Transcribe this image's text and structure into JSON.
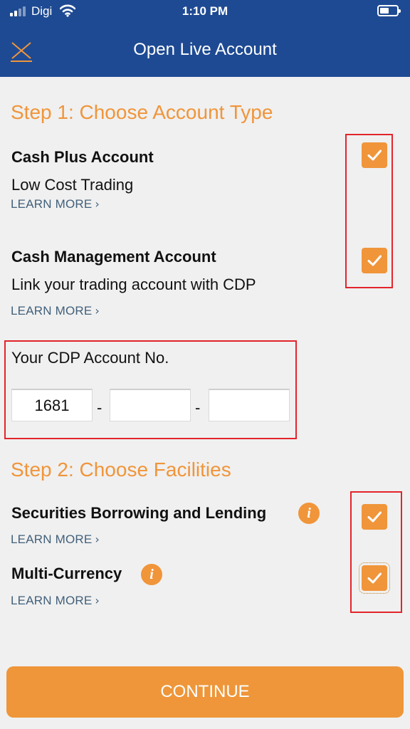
{
  "status_bar": {
    "carrier": "Digi",
    "time": "1:10 PM"
  },
  "nav": {
    "title": "Open Live Account",
    "close_icon": "close-icon"
  },
  "step1": {
    "title": "Step 1: Choose Account Type",
    "cash_plus": {
      "name": "Cash Plus Account",
      "desc": "Low Cost Trading",
      "learn_more": "LEARN MORE",
      "checked": true
    },
    "cash_mgmt": {
      "name": "Cash Management Account",
      "desc": "Link your trading account with CDP",
      "learn_more": "LEARN MORE",
      "checked": true
    },
    "cdp": {
      "label": "Your CDP Account No.",
      "part1": "1681",
      "part2": "",
      "part3": "",
      "separator": "-"
    }
  },
  "step2": {
    "title": "Step 2: Choose Facilities",
    "sbl": {
      "name": "Securities Borrowing and Lending",
      "learn_more": "LEARN MORE",
      "checked": true,
      "info_icon": "info-icon"
    },
    "multi_currency": {
      "name": "Multi-Currency",
      "learn_more": "LEARN MORE",
      "checked": true,
      "info_icon": "info-icon"
    }
  },
  "continue_button": {
    "label": "CONTINUE"
  },
  "colors": {
    "nav_bg": "#1e4a93",
    "accent": "#f0953a",
    "highlight_box": "#e3242b",
    "link": "#42607a"
  }
}
